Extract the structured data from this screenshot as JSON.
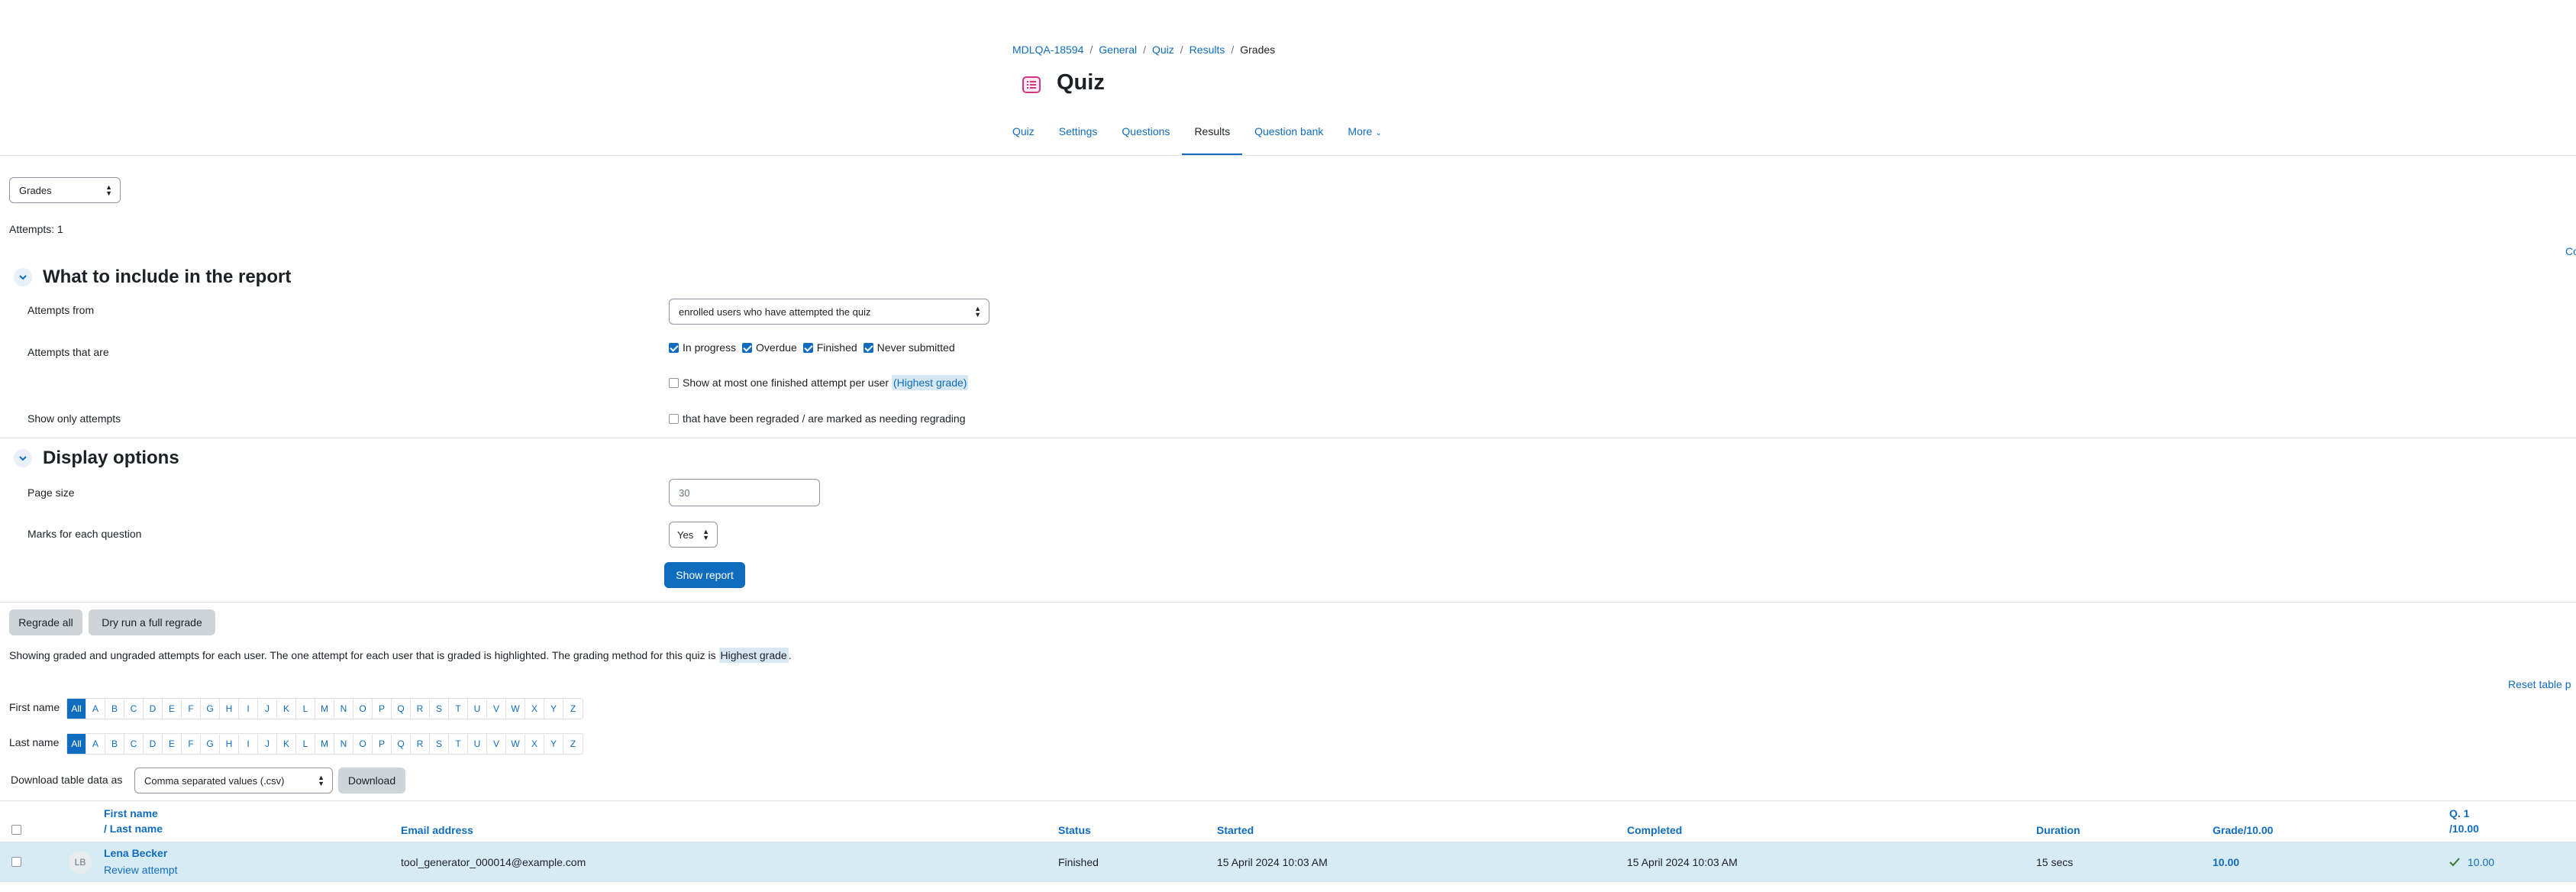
{
  "breadcrumb": {
    "items": [
      "MDLQA-18594",
      "General",
      "Quiz",
      "Results"
    ],
    "current": "Grades"
  },
  "header": {
    "title": "Quiz",
    "icon": "quiz-icon"
  },
  "tabs": [
    {
      "label": "Quiz"
    },
    {
      "label": "Settings"
    },
    {
      "label": "Questions"
    },
    {
      "label": "Results",
      "active": true
    },
    {
      "label": "Question bank"
    },
    {
      "label": "More"
    }
  ],
  "report_select": {
    "value": "Grades"
  },
  "attempts_count": "Attempts: 1",
  "edge_text": {
    "right_top": "Co",
    "reset": "Reset table p"
  },
  "section_include": {
    "title": "What to include in the report",
    "attempts_from_label": "Attempts from",
    "attempts_from_value": "enrolled users who have attempted the quiz",
    "attempts_that_are_label": "Attempts that are",
    "states": [
      {
        "label": "In progress",
        "checked": true
      },
      {
        "label": "Overdue",
        "checked": true
      },
      {
        "label": "Finished",
        "checked": true
      },
      {
        "label": "Never submitted",
        "checked": true
      }
    ],
    "one_attempt_label": "Show at most one finished attempt per user",
    "one_attempt_highlight": "(Highest grade)",
    "show_only_label": "Show only attempts",
    "regraded_label": "that have been regraded / are marked as needing regrading"
  },
  "section_display": {
    "title": "Display options",
    "page_size_label": "Page size",
    "page_size_value": "30",
    "marks_label": "Marks for each question",
    "marks_value": "Yes",
    "show_report_button": "Show report"
  },
  "regrade": {
    "all": "Regrade all",
    "dry_run": "Dry run a full regrade"
  },
  "info": {
    "text_before": "Showing graded and ungraded attempts for each user. The one attempt for each user that is graded is highlighted. The grading method for this quiz is",
    "highlight": "Highest grade",
    "text_after": "."
  },
  "initials": {
    "first_name_label": "First name",
    "last_name_label": "Last name",
    "letters": [
      "All",
      "A",
      "B",
      "C",
      "D",
      "E",
      "F",
      "G",
      "H",
      "I",
      "J",
      "K",
      "L",
      "M",
      "N",
      "O",
      "P",
      "Q",
      "R",
      "S",
      "T",
      "U",
      "V",
      "W",
      "X",
      "Y",
      "Z"
    ]
  },
  "download": {
    "label": "Download table data as",
    "format": "Comma separated values (.csv)",
    "button": "Download"
  },
  "table": {
    "headers": {
      "first_name": "First name",
      "last_name": "/ Last name",
      "email": "Email address",
      "status": "Status",
      "started": "Started",
      "completed": "Completed",
      "duration": "Duration",
      "grade": "Grade/10.00",
      "q1_top": "Q. 1",
      "q1_bottom": "/10.00"
    },
    "rows": [
      {
        "initials": "LB",
        "name": "Lena Becker",
        "review": "Review attempt",
        "email": "tool_generator_000014@example.com",
        "status": "Finished",
        "started": "15 April 2024 10:03 AM",
        "completed": "15 April 2024 10:03 AM",
        "duration": "15 secs",
        "grade": "10.00",
        "q1": "10.00"
      }
    ]
  },
  "colors": {
    "accent": "#0f6cbf",
    "highlight_row": "#d7ebf5",
    "correct": "#357a32"
  }
}
